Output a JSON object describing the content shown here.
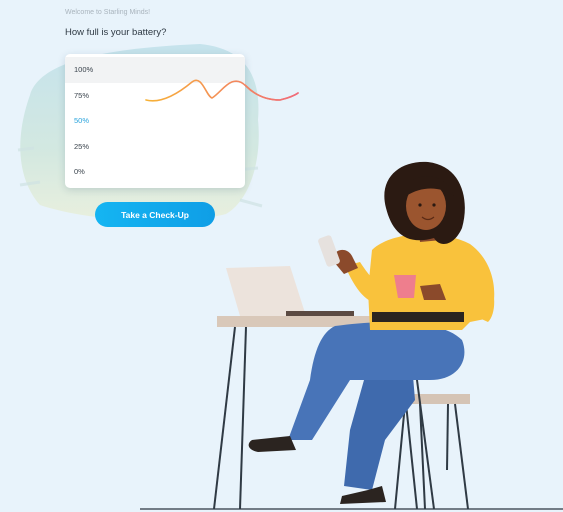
{
  "header": {
    "welcome": "Welcome to Starling Minds!",
    "question": "How full is your battery?"
  },
  "battery_dropdown": {
    "options": [
      "100%",
      "75%",
      "50%",
      "25%",
      "0%"
    ],
    "selected_index": 2,
    "hovered_index": 0
  },
  "cta": {
    "label": "Take a Check-Up"
  },
  "colors": {
    "background": "#e8f3fb",
    "accent": "#15b5f2",
    "selected_option": "#2aa4dd",
    "squiggle_start": "#f7b236",
    "squiggle_end": "#f06b7a"
  },
  "illustration": {
    "subject": "woman sitting at a cafe table with a laptop, holding a phone and a pink cup"
  }
}
